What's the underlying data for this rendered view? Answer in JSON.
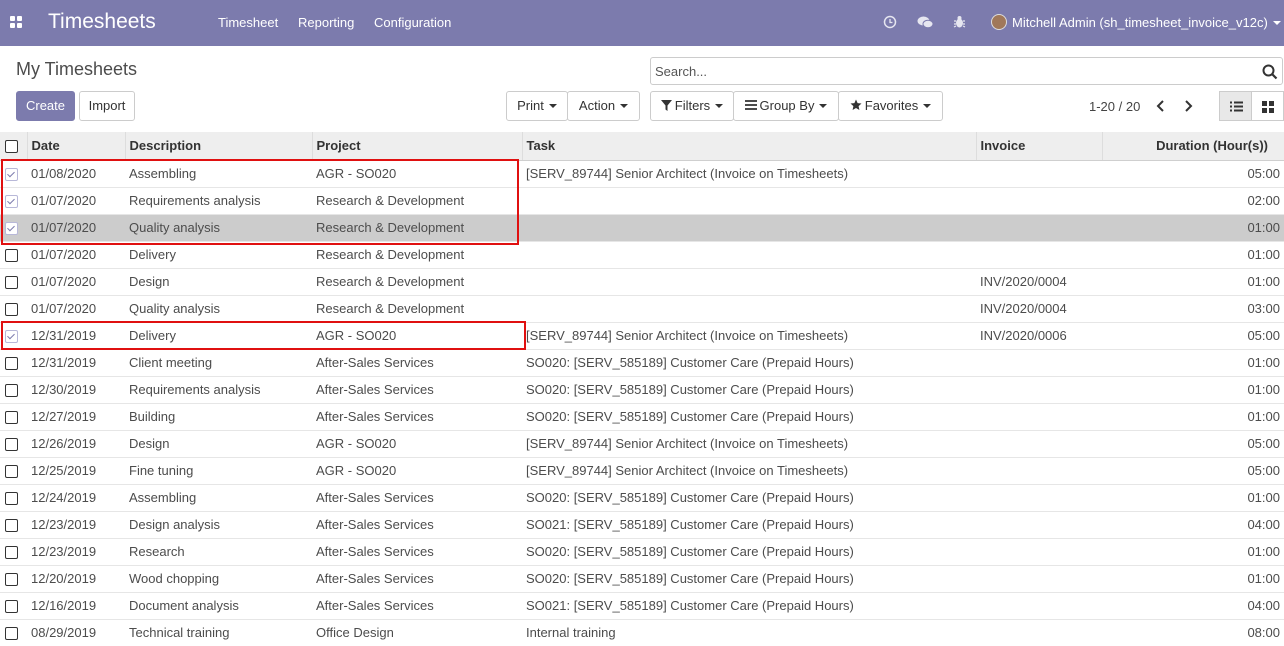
{
  "topbar": {
    "app_title": "Timesheets",
    "menus": [
      "Timesheet",
      "Reporting",
      "Configuration"
    ],
    "user": "Mitchell Admin (sh_timesheet_invoice_v12c)"
  },
  "page": {
    "title": "My Timesheets",
    "search_placeholder": "Search..."
  },
  "buttons": {
    "create": "Create",
    "import": "Import",
    "print": "Print",
    "action": "Action",
    "filters": "Filters",
    "group_by": "Group By",
    "favorites": "Favorites"
  },
  "pager": {
    "range": "1-20 / 20"
  },
  "table": {
    "headers": [
      "Date",
      "Description",
      "Project",
      "Task",
      "Invoice",
      "Duration (Hour(s))"
    ],
    "rows": [
      {
        "checked": true,
        "date": "01/08/2020",
        "desc": "Assembling",
        "project": "AGR - SO020",
        "task": "[SERV_89744] Senior Architect (Invoice on Timesheets)",
        "invoice": "",
        "duration": "05:00"
      },
      {
        "checked": true,
        "date": "01/07/2020",
        "desc": "Requirements analysis",
        "project": "Research & Development",
        "task": "",
        "invoice": "",
        "duration": "02:00"
      },
      {
        "checked": true,
        "date": "01/07/2020",
        "desc": "Quality analysis",
        "project": "Research & Development",
        "task": "",
        "invoice": "",
        "duration": "01:00"
      },
      {
        "checked": false,
        "date": "01/07/2020",
        "desc": "Delivery",
        "project": "Research & Development",
        "task": "",
        "invoice": "",
        "duration": "01:00"
      },
      {
        "checked": false,
        "date": "01/07/2020",
        "desc": "Design",
        "project": "Research & Development",
        "task": "",
        "invoice": "INV/2020/0004",
        "duration": "01:00"
      },
      {
        "checked": false,
        "date": "01/07/2020",
        "desc": "Quality analysis",
        "project": "Research & Development",
        "task": "",
        "invoice": "INV/2020/0004",
        "duration": "03:00"
      },
      {
        "checked": true,
        "date": "12/31/2019",
        "desc": "Delivery",
        "project": "AGR - SO020",
        "task": "[SERV_89744] Senior Architect (Invoice on Timesheets)",
        "invoice": "INV/2020/0006",
        "duration": "05:00"
      },
      {
        "checked": false,
        "date": "12/31/2019",
        "desc": "Client meeting",
        "project": "After-Sales Services",
        "task": "SO020: [SERV_585189] Customer Care (Prepaid Hours)",
        "invoice": "",
        "duration": "01:00"
      },
      {
        "checked": false,
        "date": "12/30/2019",
        "desc": "Requirements analysis",
        "project": "After-Sales Services",
        "task": "SO020: [SERV_585189] Customer Care (Prepaid Hours)",
        "invoice": "",
        "duration": "01:00"
      },
      {
        "checked": false,
        "date": "12/27/2019",
        "desc": "Building",
        "project": "After-Sales Services",
        "task": "SO020: [SERV_585189] Customer Care (Prepaid Hours)",
        "invoice": "",
        "duration": "01:00"
      },
      {
        "checked": false,
        "date": "12/26/2019",
        "desc": "Design",
        "project": "AGR - SO020",
        "task": "[SERV_89744] Senior Architect (Invoice on Timesheets)",
        "invoice": "",
        "duration": "05:00"
      },
      {
        "checked": false,
        "date": "12/25/2019",
        "desc": "Fine tuning",
        "project": "AGR - SO020",
        "task": "[SERV_89744] Senior Architect (Invoice on Timesheets)",
        "invoice": "",
        "duration": "05:00"
      },
      {
        "checked": false,
        "date": "12/24/2019",
        "desc": "Assembling",
        "project": "After-Sales Services",
        "task": "SO020: [SERV_585189] Customer Care (Prepaid Hours)",
        "invoice": "",
        "duration": "01:00"
      },
      {
        "checked": false,
        "date": "12/23/2019",
        "desc": "Design analysis",
        "project": "After-Sales Services",
        "task": "SO021: [SERV_585189] Customer Care (Prepaid Hours)",
        "invoice": "",
        "duration": "04:00"
      },
      {
        "checked": false,
        "date": "12/23/2019",
        "desc": "Research",
        "project": "After-Sales Services",
        "task": "SO020: [SERV_585189] Customer Care (Prepaid Hours)",
        "invoice": "",
        "duration": "01:00"
      },
      {
        "checked": false,
        "date": "12/20/2019",
        "desc": "Wood chopping",
        "project": "After-Sales Services",
        "task": "SO020: [SERV_585189] Customer Care (Prepaid Hours)",
        "invoice": "",
        "duration": "01:00"
      },
      {
        "checked": false,
        "date": "12/16/2019",
        "desc": "Document analysis",
        "project": "After-Sales Services",
        "task": "SO021: [SERV_585189] Customer Care (Prepaid Hours)",
        "invoice": "",
        "duration": "04:00"
      },
      {
        "checked": false,
        "date": "08/29/2019",
        "desc": "Technical training",
        "project": "Office Design",
        "task": "Internal training",
        "invoice": "",
        "duration": "08:00"
      }
    ]
  },
  "colors": {
    "brand": "#7c7bad",
    "highlight_box": "#e01010",
    "selected_row": "#cccccc"
  }
}
